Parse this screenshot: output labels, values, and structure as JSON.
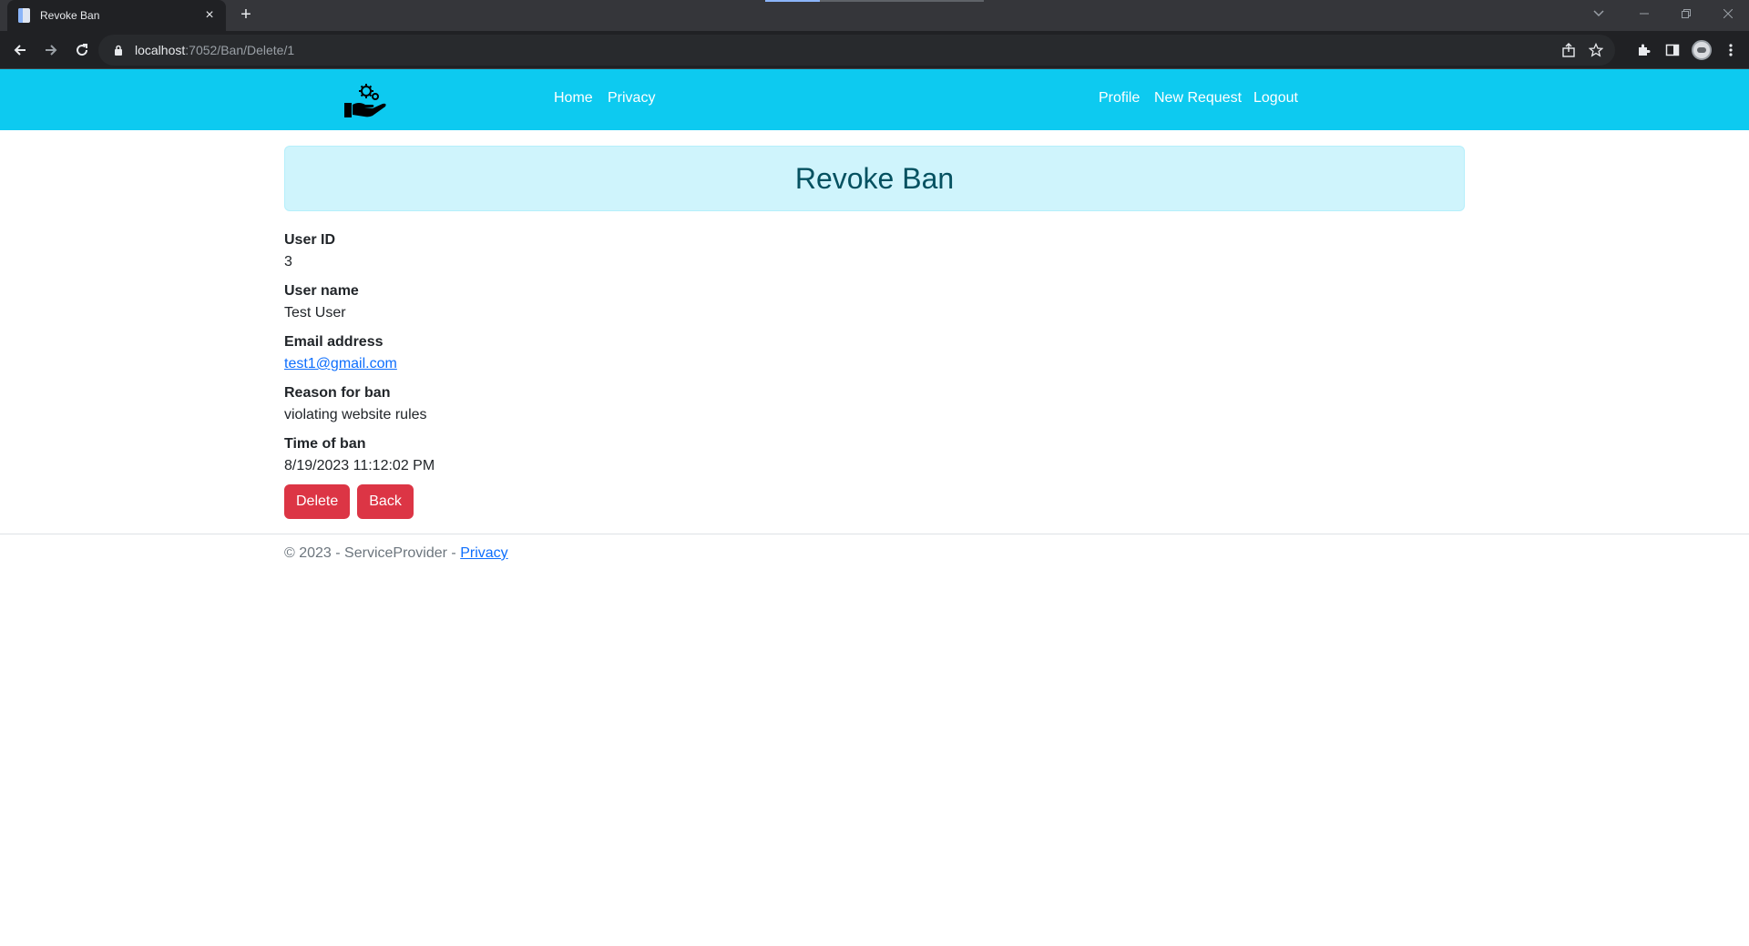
{
  "browser": {
    "tab_title": "Revoke Ban",
    "tab_close": "×",
    "new_tab": "+",
    "url_host": "localhost",
    "url_path": ":7052/Ban/Delete/1",
    "loading_progress": 0.25
  },
  "nav": {
    "links": [
      {
        "label": "Home"
      },
      {
        "label": "Privacy"
      },
      {
        "label": "Profile"
      },
      {
        "label": "New Request"
      },
      {
        "label": "Logout"
      }
    ]
  },
  "page": {
    "heading": "Revoke Ban",
    "fields": [
      {
        "label": "User ID",
        "value": "3"
      },
      {
        "label": "User name",
        "value": "Test User"
      },
      {
        "label": "Email address",
        "value": "test1@gmail.com"
      },
      {
        "label": "Reason for ban",
        "value": "violating website rules"
      },
      {
        "label": "Time of ban",
        "value": "8/19/2023 11:12:02 PM"
      }
    ],
    "delete_button": "Delete",
    "back_button": "Back"
  },
  "footer": {
    "text": "© 2023 - ServiceProvider - ",
    "privacy_link": "Privacy"
  },
  "colors": {
    "navbar": "#0dcaf0",
    "alert_bg": "#cff4fc",
    "alert_text": "#055160",
    "danger": "#dc3545",
    "link": "#0d6efd"
  }
}
